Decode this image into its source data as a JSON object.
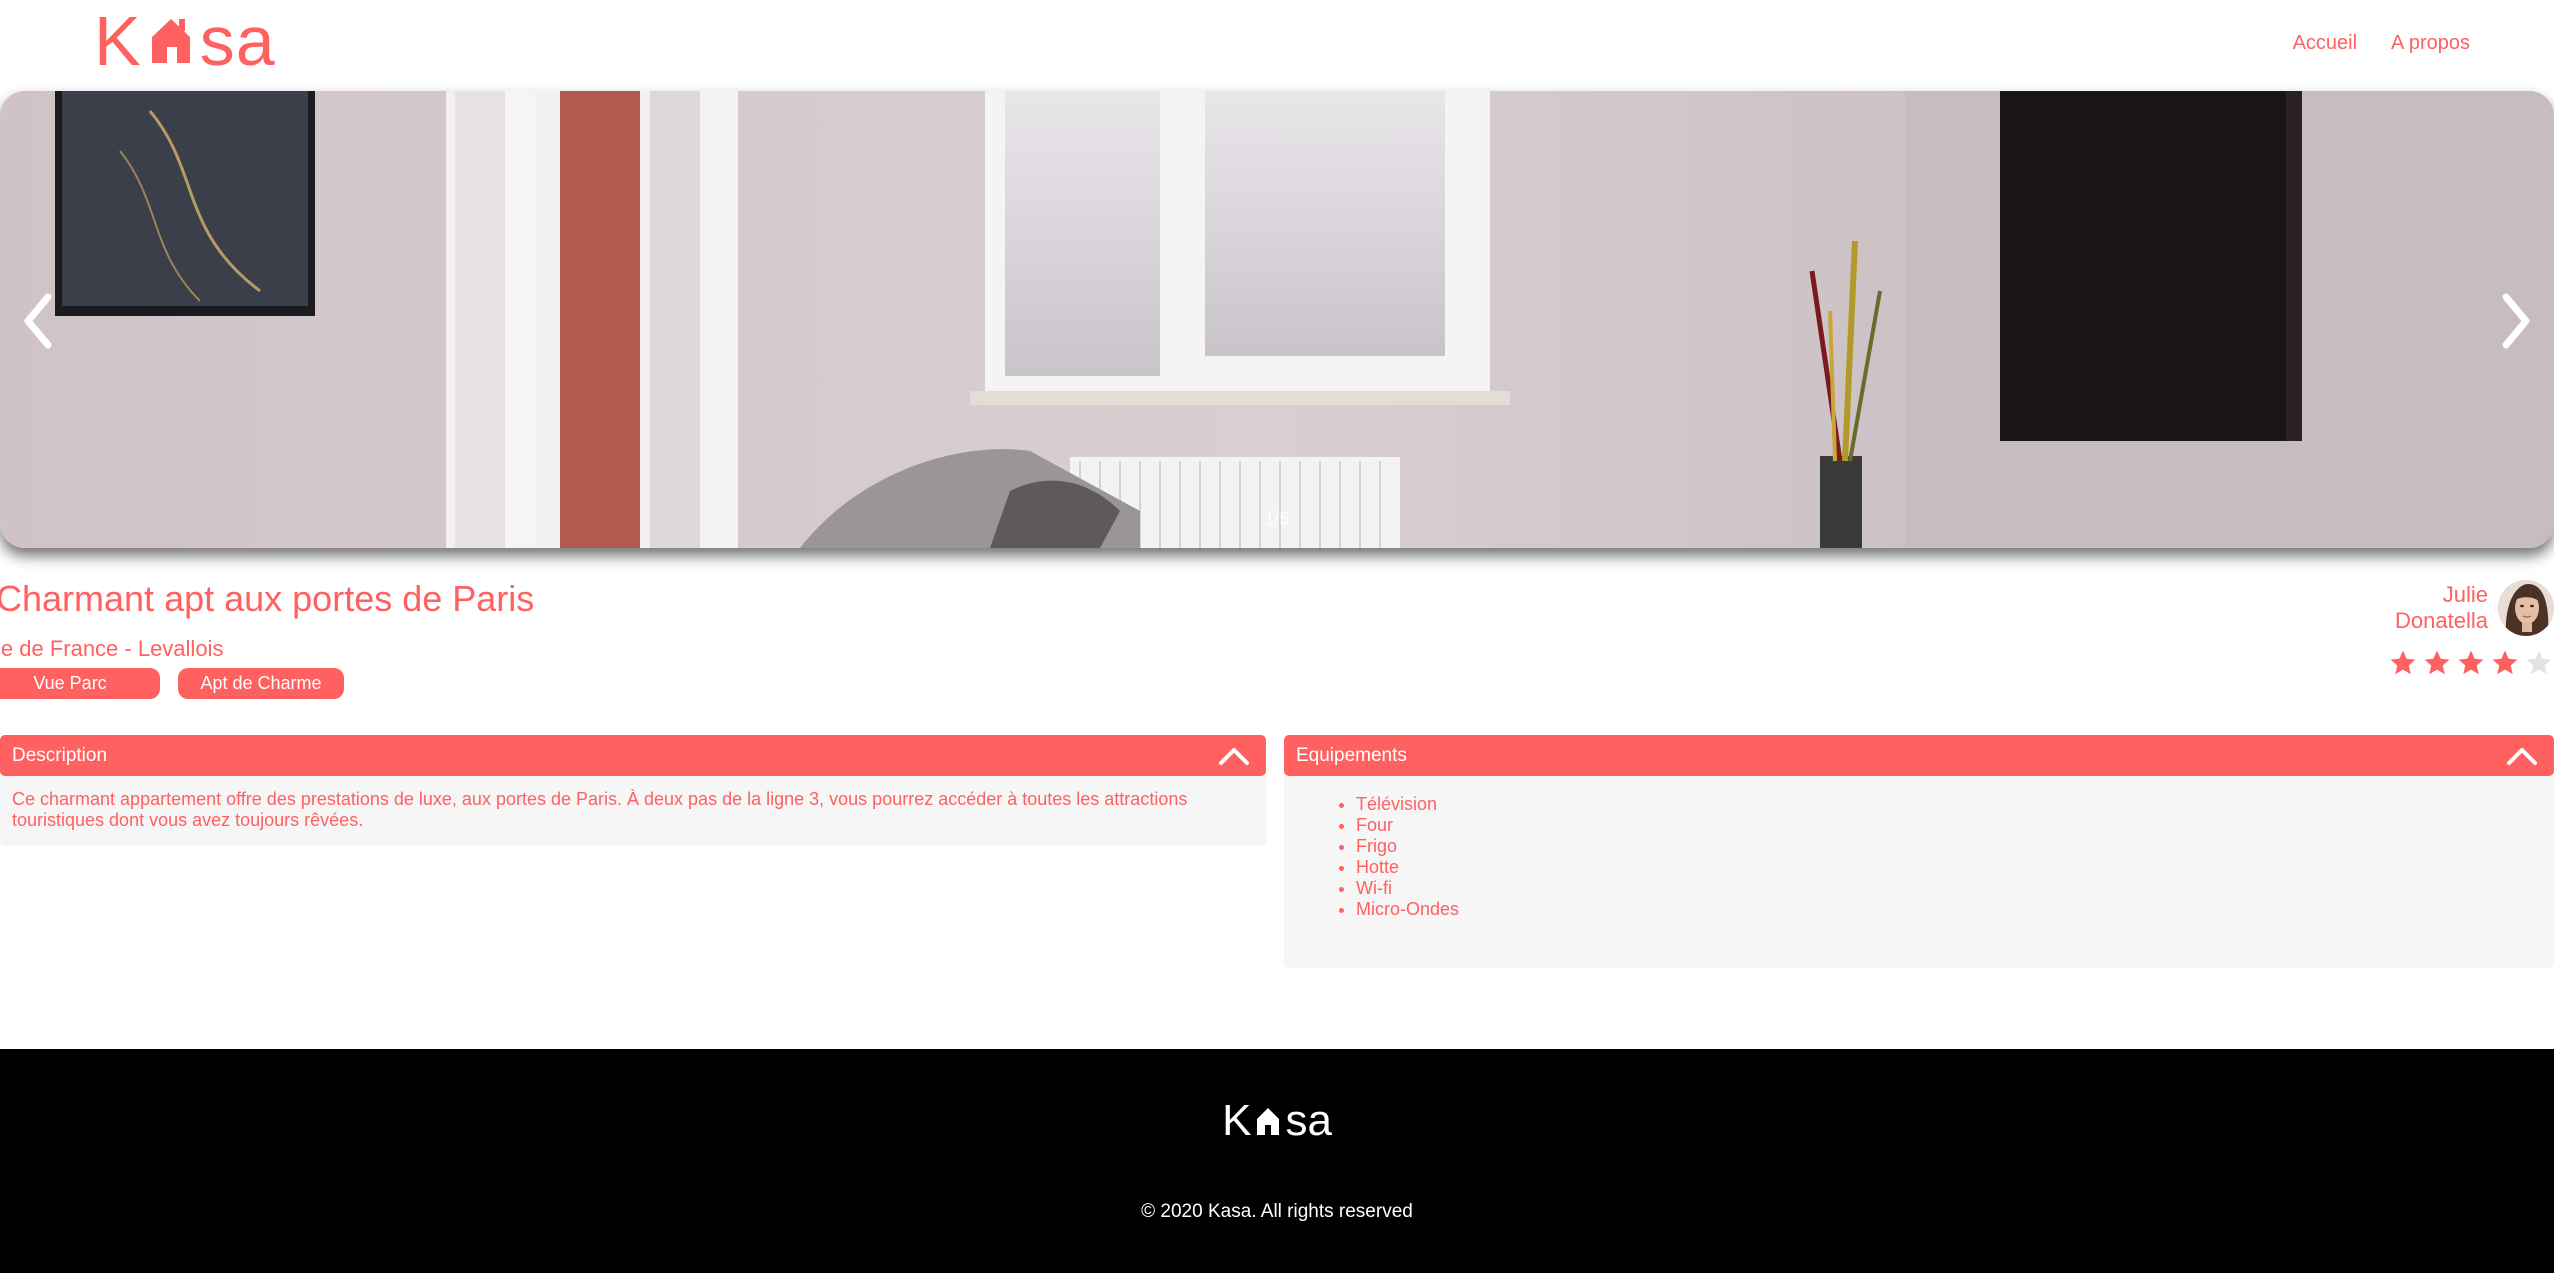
{
  "header": {
    "logo": {
      "before": "K",
      "after": "sa"
    },
    "nav": [
      {
        "label": "Accueil"
      },
      {
        "label": "A propos"
      }
    ]
  },
  "carousel": {
    "counter": "1/5",
    "current": 1,
    "total": 5
  },
  "listing": {
    "title": "Charmant apt aux portes de Paris",
    "location": "le de France - Levallois",
    "tags": [
      "Vue Parc",
      "Apt de Charme"
    ]
  },
  "host": {
    "first_name": "Julie",
    "last_name": "Donatella"
  },
  "rating": {
    "value": 4,
    "max": 5,
    "filled_color": "#FF6060",
    "empty_color": "#E3E3E3"
  },
  "description": {
    "header": "Description",
    "body": "Ce charmant appartement offre des prestations de luxe, aux portes de Paris. À deux pas de la ligne 3, vous pourrez accéder à toutes les attractions touristiques dont vous avez toujours rêvées."
  },
  "equipments": {
    "header": "Equipements",
    "items": [
      "Télévision",
      "Four",
      "Frigo",
      "Hotte",
      "Wi-fi",
      "Micro-Ondes"
    ]
  },
  "footer": {
    "logo": {
      "before": "K",
      "after": "sa"
    },
    "copyright": "© 2020 Kasa. All rights reserved"
  },
  "colors": {
    "brand": "#FF6060",
    "panel": "#F6F6F6",
    "footer_bg": "#000000"
  }
}
